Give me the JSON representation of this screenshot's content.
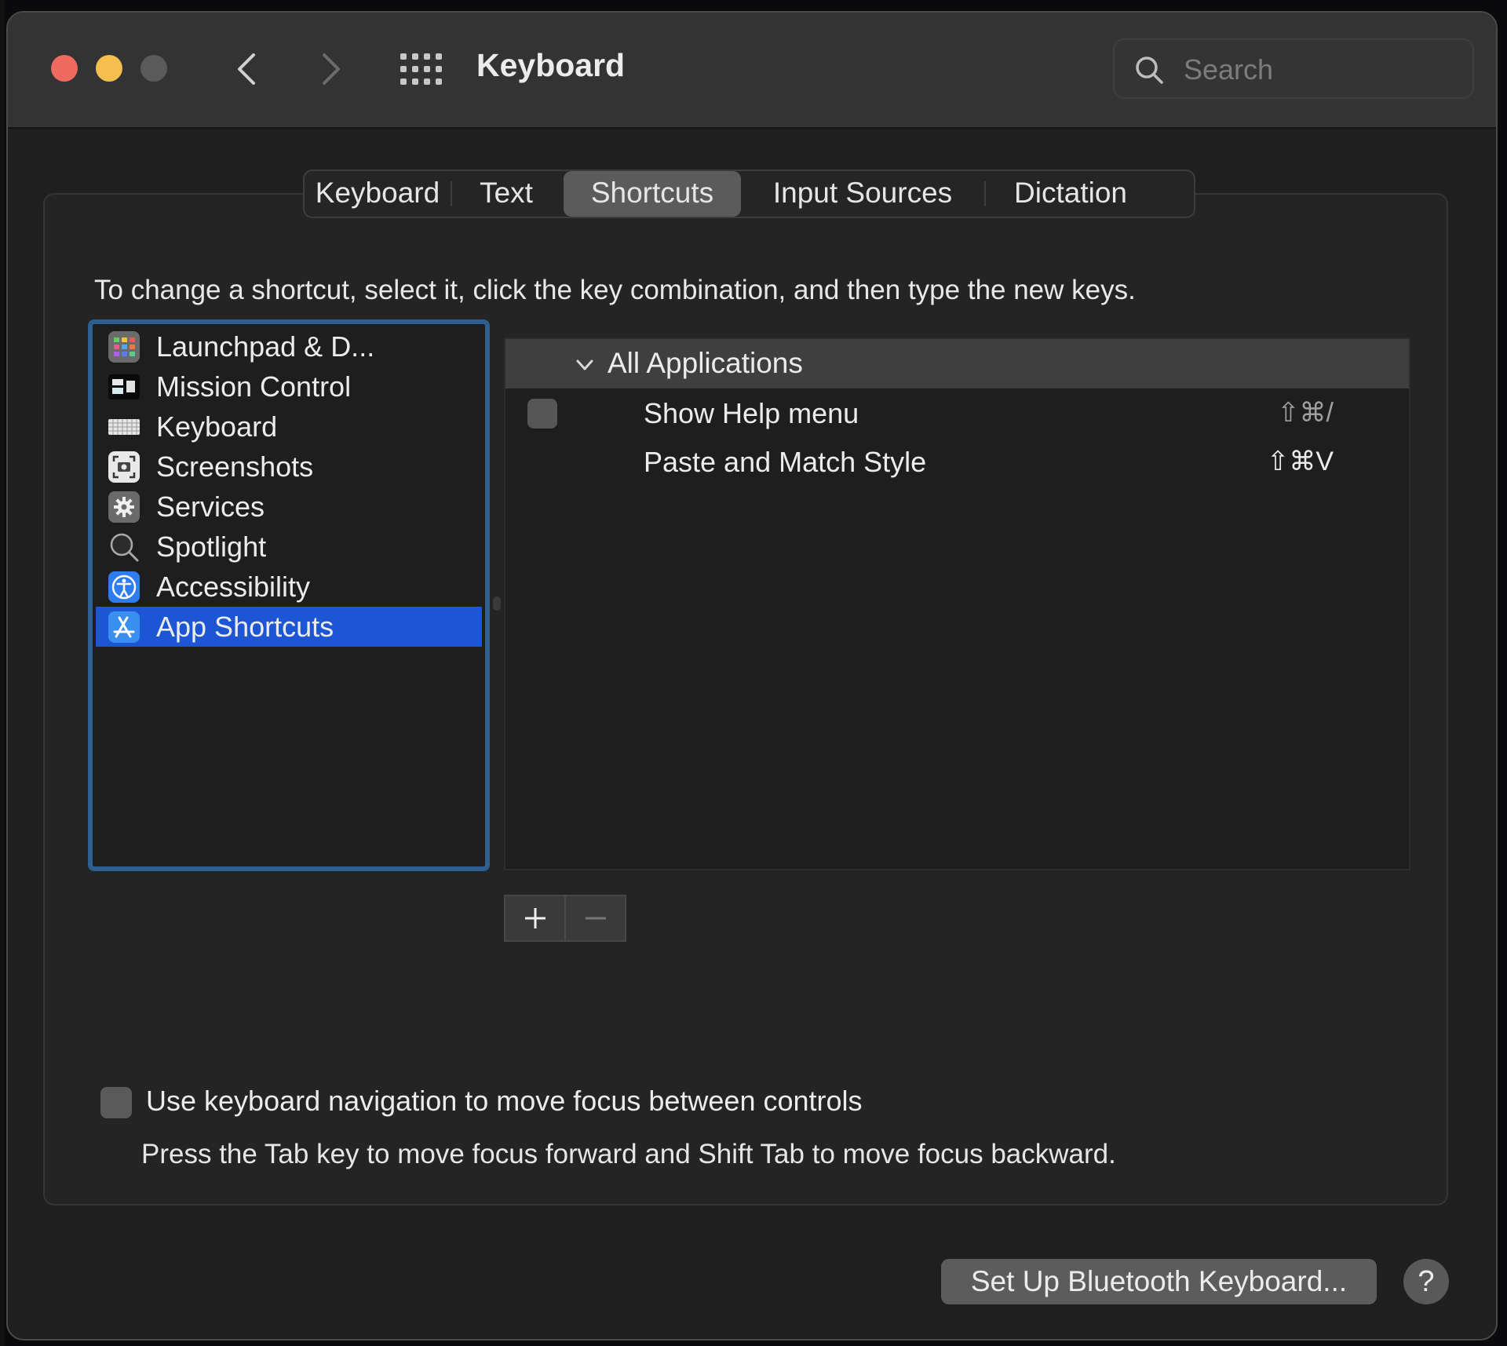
{
  "window": {
    "title": "Keyboard",
    "traffic_lights": {
      "close_color": "#ec6a5e",
      "minimize_color": "#f4bf4f",
      "zoom_color": "#5a5a5a"
    },
    "search": {
      "placeholder": "Search",
      "value": ""
    }
  },
  "tabs": [
    {
      "label": "Keyboard",
      "selected": false
    },
    {
      "label": "Text",
      "selected": false
    },
    {
      "label": "Shortcuts",
      "selected": true
    },
    {
      "label": "Input Sources",
      "selected": false
    },
    {
      "label": "Dictation",
      "selected": false
    }
  ],
  "instruction": "To change a shortcut, select it, click the key combination, and then type the new keys.",
  "categories": [
    {
      "label": "Launchpad & D...",
      "icon": "launchpad-icon",
      "selected": false
    },
    {
      "label": "Mission Control",
      "icon": "mission-control-icon",
      "selected": false
    },
    {
      "label": "Keyboard",
      "icon": "keyboard-icon",
      "selected": false
    },
    {
      "label": "Screenshots",
      "icon": "screenshot-icon",
      "selected": false
    },
    {
      "label": "Services",
      "icon": "gear-icon",
      "selected": false
    },
    {
      "label": "Spotlight",
      "icon": "spotlight-icon",
      "selected": false
    },
    {
      "label": "Accessibility",
      "icon": "accessibility-icon",
      "selected": false
    },
    {
      "label": "App Shortcuts",
      "icon": "app-store-icon",
      "selected": true
    }
  ],
  "shortcuts": {
    "group_label": "All Applications",
    "group_expanded": true,
    "rows": [
      {
        "name": "Show Help menu",
        "keys": "⇧⌘/",
        "checkbox": true,
        "checked": false
      },
      {
        "name": "Paste and Match Style",
        "keys": "⇧⌘V",
        "checkbox": false,
        "checked": false
      }
    ],
    "add_label": "+",
    "remove_label": "−"
  },
  "keyboard_navigation": {
    "label": "Use keyboard navigation to move focus between controls",
    "checked": false,
    "hint": "Press the Tab key to move focus forward and Shift Tab to move focus backward."
  },
  "footer": {
    "bluetooth_button": "Set Up Bluetooth Keyboard...",
    "help_button": "?"
  },
  "colors": {
    "selection": "#1c56d4",
    "focus_ring": "#2f5f90"
  }
}
